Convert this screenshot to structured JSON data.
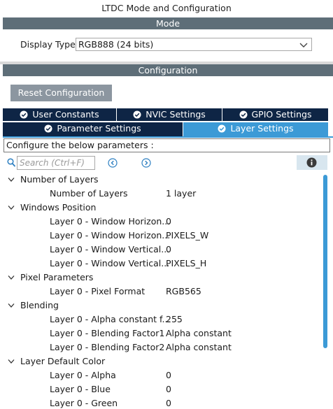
{
  "window": {
    "title": "LTDC Mode and Configuration"
  },
  "mode": {
    "header": "Mode",
    "display_type_label": "Display Type",
    "display_type_value": "RGB888 (24 bits)"
  },
  "configuration": {
    "header": "Configuration",
    "reset_label": "Reset Configuration",
    "tabs_row1": [
      {
        "label": "User Constants"
      },
      {
        "label": "NVIC Settings"
      },
      {
        "label": "GPIO Settings"
      }
    ],
    "tabs_row2": [
      {
        "label": "Parameter Settings"
      },
      {
        "label": "Layer Settings"
      }
    ],
    "active_tab": "Layer Settings",
    "configure_text": "Configure the below parameters :",
    "search_placeholder": "Search (Ctrl+F)",
    "groups": [
      {
        "name": "Number of Layers",
        "params": [
          {
            "name": "Number of Layers",
            "value": "1 layer"
          }
        ]
      },
      {
        "name": "Windows Position",
        "params": [
          {
            "name": "Layer 0 - Window Horizon...",
            "value": "0"
          },
          {
            "name": "Layer 0 - Window Horizon...",
            "value": "PIXELS_W"
          },
          {
            "name": "Layer 0 - Window Vertical...",
            "value": "0"
          },
          {
            "name": "Layer 0 - Window Vertical...",
            "value": "PIXELS_H"
          }
        ]
      },
      {
        "name": "Pixel Parameters",
        "params": [
          {
            "name": "Layer 0 - Pixel Format",
            "value": "RGB565"
          }
        ]
      },
      {
        "name": "Blending",
        "params": [
          {
            "name": "Layer 0 - Alpha constant f...",
            "value": "255"
          },
          {
            "name": "Layer 0 - Blending Factor1",
            "value": "Alpha constant"
          },
          {
            "name": "Layer 0 - Blending Factor2",
            "value": "Alpha constant"
          }
        ]
      },
      {
        "name": "Layer Default Color",
        "params": [
          {
            "name": "Layer 0 - Alpha",
            "value": "0"
          },
          {
            "name": "Layer 0 - Blue",
            "value": "0"
          },
          {
            "name": "Layer 0 - Green",
            "value": "0"
          }
        ]
      }
    ]
  },
  "icons": {
    "search": "search-icon",
    "prev": "circle-chevron-left-icon",
    "next": "circle-chevron-right-icon",
    "info": "info-icon",
    "check": "check-circle-icon",
    "expand": "chevron-down-icon",
    "dropdown": "chevron-down-icon"
  },
  "colors": {
    "section_bar": "#5e6e78",
    "tab_dark": "#0e2545",
    "tab_active": "#3c9ad6",
    "reset_button": "#8c96a0"
  }
}
